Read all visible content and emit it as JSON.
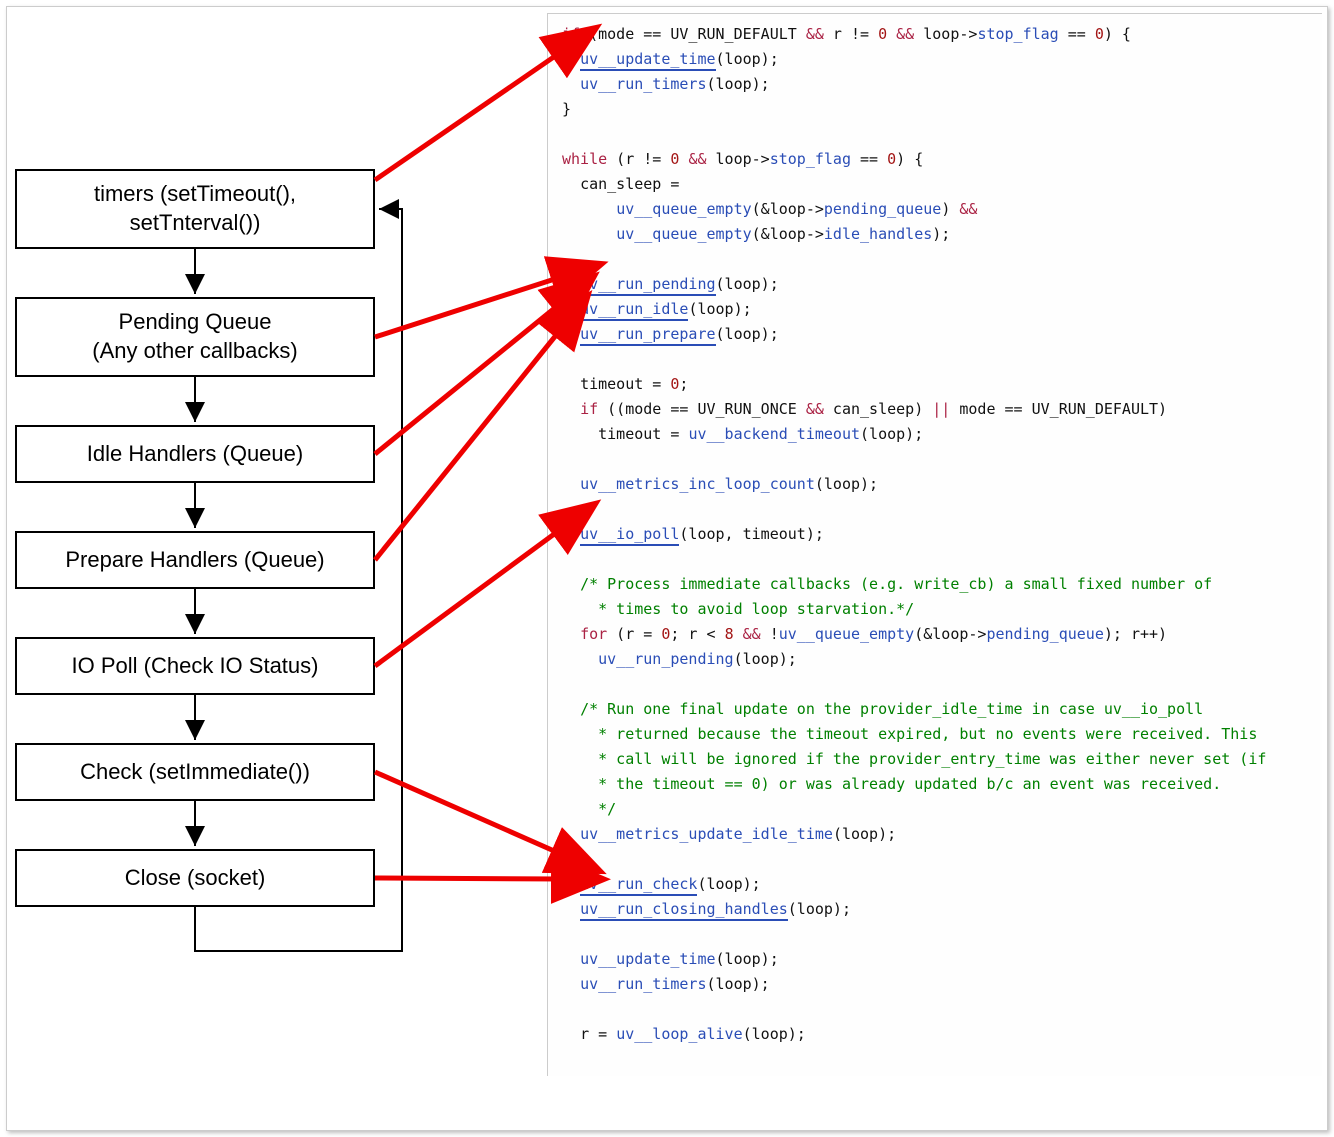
{
  "flow": {
    "boxes": [
      {
        "key": "timers",
        "label": "timers (setTimeout(),\nsetTnterval())"
      },
      {
        "key": "pending",
        "label": "Pending Queue\n(Any other callbacks)"
      },
      {
        "key": "idle",
        "label": "Idle Handlers (Queue)"
      },
      {
        "key": "prepare",
        "label": "Prepare Handlers (Queue)"
      },
      {
        "key": "iopoll",
        "label": "IO Poll (Check IO Status)"
      },
      {
        "key": "check",
        "label": "Check (setImmediate())"
      },
      {
        "key": "close",
        "label": "Close (socket)"
      }
    ]
  },
  "code": {
    "c0": "if",
    "c1": " (mode == UV_RUN_DEFAULT ",
    "c2": "&&",
    "c3": " r != ",
    "c4": "0",
    "c5": " ",
    "c6": "&&",
    "c7": " loop->",
    "c8": "stop_flag",
    "c9": " == ",
    "c10": "0",
    "c11": ") {",
    "c12": "uv__update_time",
    "c13": "(loop);",
    "c14": "uv__run_timers",
    "c15": "(loop);",
    "c16": "}",
    "c17": "while",
    "c18": " (r != ",
    "c19": "0",
    "c20": " ",
    "c21": "&&",
    "c22": " loop->",
    "c23": "stop_flag",
    "c24": " == ",
    "c25": "0",
    "c26": ") {",
    "c27": "can_sleep =",
    "c28": "uv__queue_empty",
    "c29": "(&loop->",
    "c30": "pending_queue",
    "c31": ") ",
    "c32": "&&",
    "c33": "uv__queue_empty",
    "c34": "(&loop->",
    "c35": "idle_handles",
    "c36": ");",
    "c37": "uv__run_pending",
    "c38": "(loop);",
    "c39": "uv__run_idle",
    "c40": "(loop);",
    "c41": "uv__run_prepare",
    "c42": "(loop);",
    "c43": "timeout = ",
    "c44": "0",
    "c45": ";",
    "c46": "if",
    "c47": " ((mode == UV_RUN_ONCE ",
    "c48": "&&",
    "c49": " can_sleep) ",
    "c50": "||",
    "c51": " mode == UV_RUN_DEFAULT)",
    "c52": "timeout = ",
    "c53": "uv__backend_timeout",
    "c54": "(loop);",
    "c55": "uv__metrics_inc_loop_count",
    "c56": "(loop);",
    "c57": "uv__io_poll",
    "c58": "(loop, timeout);",
    "c59": "/* Process immediate callbacks (e.g. write_cb) a small fixed number of",
    "c60": " * times to avoid loop starvation.*/",
    "c61": "for",
    "c62": " (r = ",
    "c63": "0",
    "c64": "; r < ",
    "c65": "8",
    "c66": " ",
    "c67": "&&",
    "c68": " !",
    "c69": "uv__queue_empty",
    "c70": "(&loop->",
    "c71": "pending_queue",
    "c72": "); r++)",
    "c73": "uv__run_pending",
    "c74": "(loop);",
    "c75": "/* Run one final update on the provider_idle_time in case uv__io_poll",
    "c76": " * returned because the timeout expired, but no events were received. This",
    "c77": " * call will be ignored if the provider_entry_time was either never set (if",
    "c78": " * the timeout == 0) or was already updated b/c an event was received.",
    "c79": " */",
    "c80": "uv__metrics_update_idle_time",
    "c81": "(loop);",
    "c82": "uv__run_check",
    "c83": "(loop);",
    "c84": "uv__run_closing_handles",
    "c85": "(loop);",
    "c86": "uv__update_time",
    "c87": "(loop);",
    "c88": "uv__run_timers",
    "c89": "(loop);",
    "c90": "r = ",
    "c91": "uv__loop_alive",
    "c92": "(loop);"
  },
  "arrows": {
    "red": [
      {
        "from": "timers",
        "to_line": 1
      },
      {
        "from": "pending",
        "to_line": 10
      },
      {
        "from": "idle",
        "to_line": 11
      },
      {
        "from": "prepare",
        "to_line": 12
      },
      {
        "from": "iopoll",
        "to_line": 20
      },
      {
        "from": "check",
        "to_line": 33
      },
      {
        "from": "close",
        "to_line": 34
      }
    ]
  }
}
